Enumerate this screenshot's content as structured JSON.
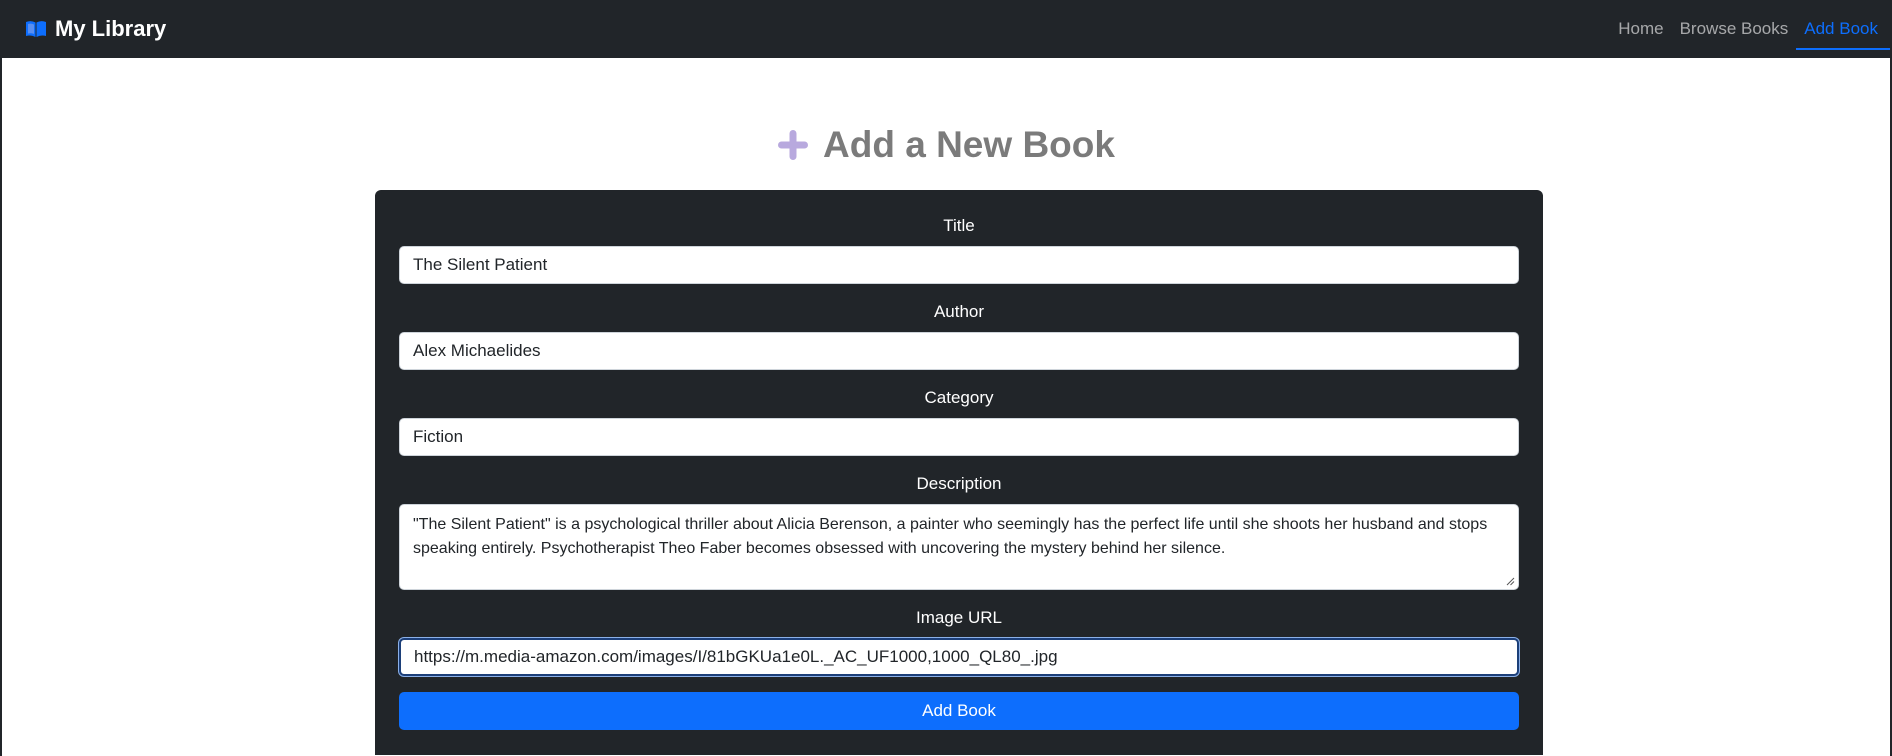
{
  "navbar": {
    "brand": "My Library",
    "brand_icon": "open-book-icon",
    "links": [
      {
        "label": "Home",
        "active": false
      },
      {
        "label": "Browse Books",
        "active": false
      },
      {
        "label": "Add Book",
        "active": true
      }
    ],
    "accent_color": "#0d6efd",
    "background_color": "#212529"
  },
  "heading": {
    "text": "Add a New Book",
    "icon": "plus-icon",
    "icon_color": "#b8a9de"
  },
  "form": {
    "fields": {
      "title": {
        "label": "Title",
        "value": "The Silent Patient"
      },
      "author": {
        "label": "Author",
        "value": "Alex Michaelides"
      },
      "category": {
        "label": "Category",
        "value": "Fiction"
      },
      "description": {
        "label": "Description",
        "value": "\"The Silent Patient\" is a psychological thriller about Alicia Berenson, a painter who seemingly has the perfect life until she shoots her husband and stops speaking entirely. Psychotherapist Theo Faber becomes obsessed with uncovering the mystery behind her silence."
      },
      "image_url": {
        "label": "Image URL",
        "value": "https://m.media-amazon.com/images/I/81bGKUa1e0L._AC_UF1000,1000_QL80_.jpg"
      }
    },
    "submit_label": "Add Book"
  }
}
